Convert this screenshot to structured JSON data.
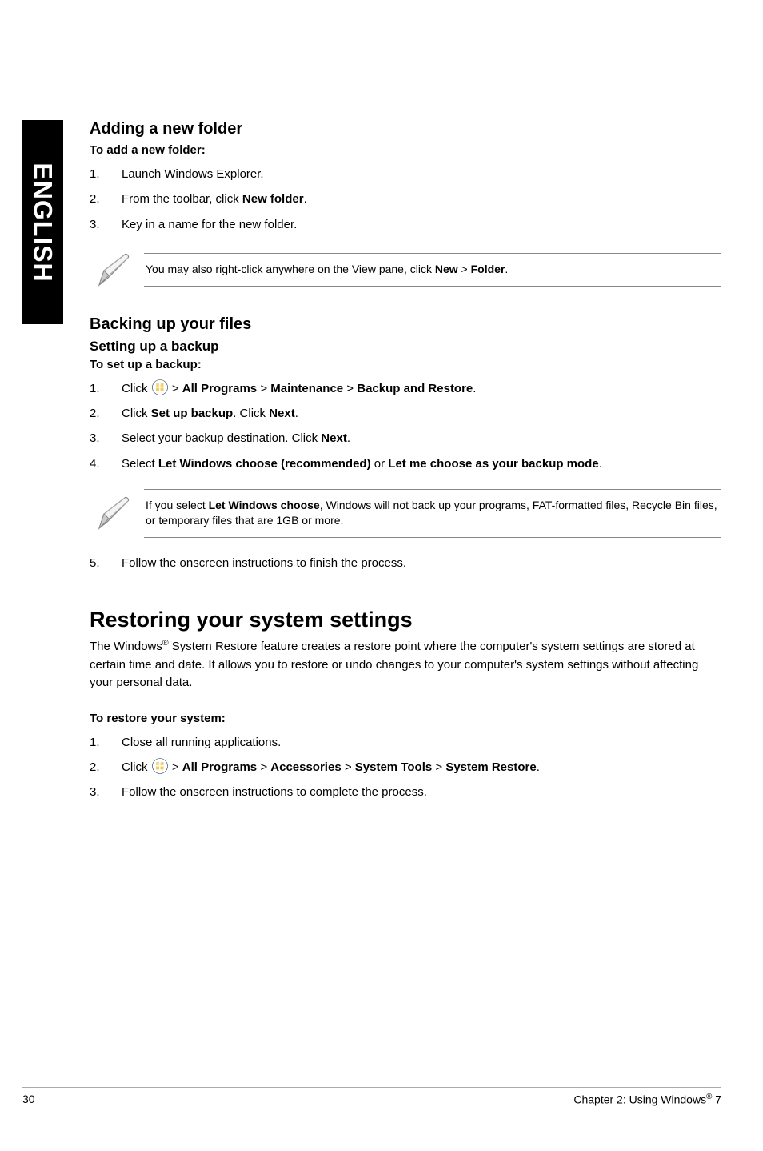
{
  "side_label": "ENGLISH",
  "sec1": {
    "heading": "Adding a new folder",
    "lead": "To add a new folder:",
    "steps": [
      "Launch Windows Explorer.",
      "From the toolbar, click <b>New folder</b>.",
      "Key in a name for the new folder."
    ],
    "note": "You may also right-click anywhere on the View pane, click <b>New</b> > <b>Folder</b>."
  },
  "sec2": {
    "heading": "Backing up your files",
    "sub": "Setting up a backup",
    "lead": "To set up a backup:",
    "steps": [
      "Click {ORB} > <b>All Programs</b> > <b>Maintenance</b> > <b>Backup and Restore</b>.",
      "Click <b>Set up backup</b>. Click <b>Next</b>.",
      "Select your backup destination. Click <b>Next</b>.",
      "Select <b>Let Windows choose (recommended)</b> or <b>Let me choose as your backup mode</b>."
    ],
    "note": "If you select <b>Let Windows choose</b>, Windows will not back up your programs, FAT-formatted files, Recycle Bin files, or temporary files that are 1GB or more.",
    "step5": "Follow the onscreen instructions to finish the process."
  },
  "sec3": {
    "heading": "Restoring your system settings",
    "para": "The Windows<sup>®</sup> System Restore feature creates a restore point where the computer's system settings are stored at certain time and date. It allows you to restore or undo changes to your computer's system settings without affecting your personal data.",
    "lead": "To restore your system:",
    "steps": [
      "Close all running applications.",
      "Click {ORB} > <b>All Programs</b> > <b>Accessories</b> > <b>System Tools</b> > <b>System Restore</b>.",
      "Follow the onscreen instructions to complete the process."
    ]
  },
  "footer": {
    "page": "30",
    "chapter": "Chapter 2: Using Windows<sup>®</sup> 7"
  }
}
